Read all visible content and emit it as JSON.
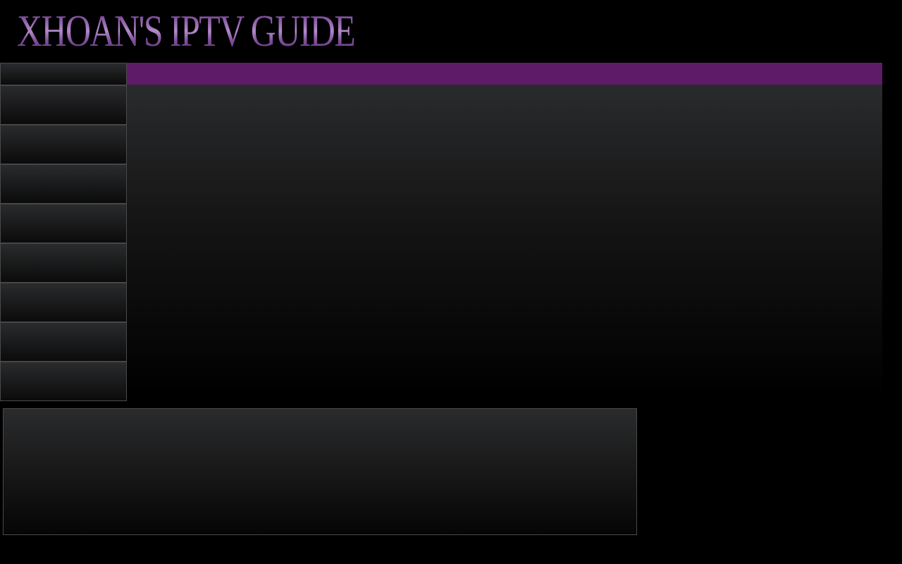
{
  "header": {
    "logo_text": "XHOAN'S IPTV GUIDE"
  },
  "colors": {
    "background": "#000000",
    "accent_bar": "#5e1c68",
    "logo_purple": "#8e5ba6",
    "panel_top": "#2a2b2d",
    "panel_bottom": "#000000",
    "border": "#4a4a4a"
  },
  "sidebar": {
    "item_count": 8
  }
}
